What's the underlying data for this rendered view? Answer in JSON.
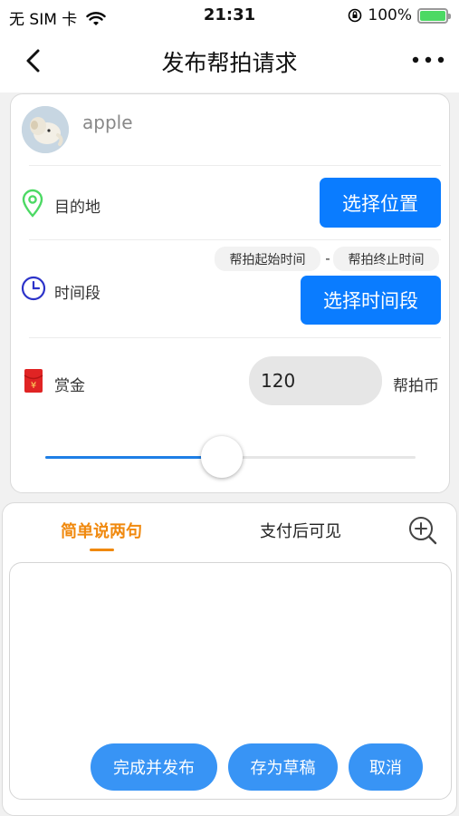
{
  "status_bar": {
    "carrier": "无 SIM 卡",
    "time": "21:31",
    "battery": "100%"
  },
  "nav": {
    "title": "发布帮拍请求"
  },
  "user": {
    "name": "apple"
  },
  "destination": {
    "label": "目的地",
    "button": "选择位置"
  },
  "time_period": {
    "label": "时间段",
    "start_chip": "帮拍起始时间",
    "dash": "-",
    "end_chip": "帮拍终止时间",
    "button": "选择时间段"
  },
  "reward": {
    "label": "赏金",
    "value": "120",
    "unit": "帮拍币",
    "slider_fraction": 0.5
  },
  "tabs": [
    {
      "label": "简单说两句",
      "active": true
    },
    {
      "label": "支付后可见",
      "active": false
    }
  ],
  "actions": {
    "publish": "完成并发布",
    "draft": "存为草稿",
    "cancel": "取消"
  },
  "colors": {
    "accent_blue": "#0a7cff",
    "tab_active": "#f0890e",
    "destination_icon": "#4cd964",
    "time_icon": "#2c33c9",
    "reward_icon": "#e02424"
  }
}
